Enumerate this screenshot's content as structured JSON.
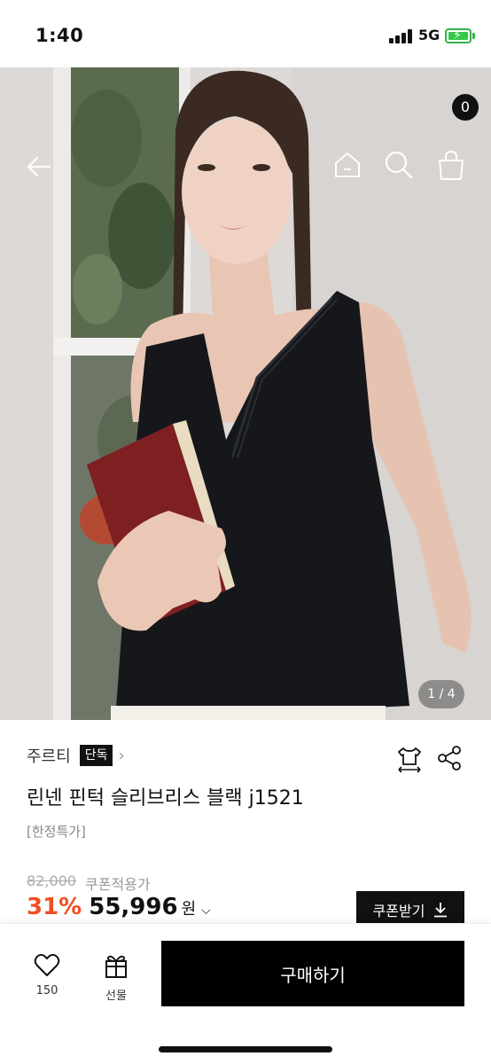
{
  "status_bar": {
    "time": "1:40",
    "network": "5G",
    "battery_color": "#33c94a"
  },
  "hero": {
    "icons": [
      "arrow-left-icon",
      "home-icon",
      "search-icon",
      "shopping-bag-icon"
    ],
    "cart_count": "0",
    "image_counter": "1 / 4"
  },
  "product": {
    "brand": "주르티",
    "exclusive_badge": "단독",
    "name": "린넨 핀턱 슬리브리스 블랙 j1521",
    "tag": "[한정특가]",
    "original_price": "82,000",
    "coupon_price_label": "쿠폰적용가",
    "discount": "31%",
    "price": "55,996",
    "currency": "원",
    "discount_color": "#f04e23"
  },
  "actions": {
    "coupon_button": "쿠폰받기",
    "like_count": "150",
    "gift_label": "선물",
    "buy_button": "구매하기"
  }
}
